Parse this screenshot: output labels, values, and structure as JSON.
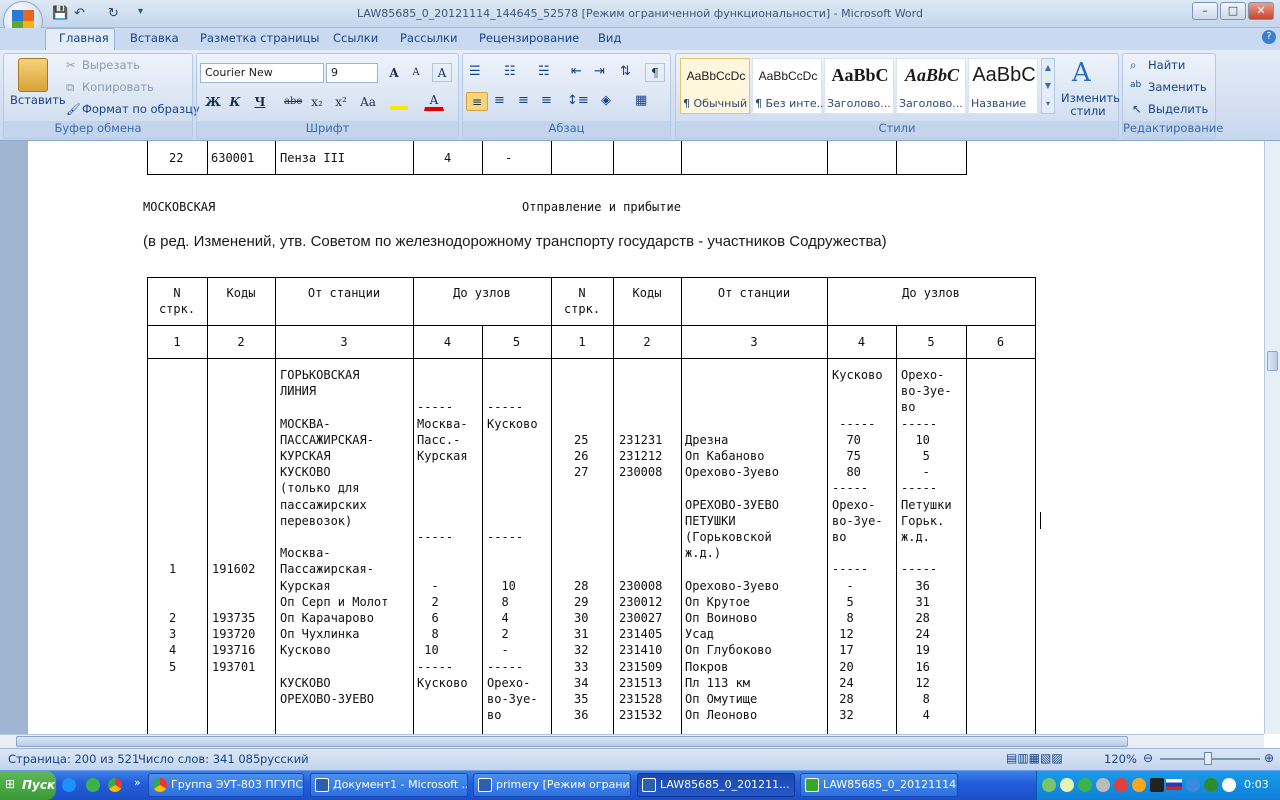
{
  "window": {
    "title": "LAW85685_0_20121114_144645_52578 [Режим ограниченной функциональности] - Microsoft Word",
    "controls": {
      "minimize": "–",
      "maximize": "□",
      "close": "✕"
    }
  },
  "quick_access": {
    "save": "💾",
    "undo": "↶",
    "redo": "↻",
    "more": "▾"
  },
  "tabs": [
    "Главная",
    "Вставка",
    "Разметка страницы",
    "Ссылки",
    "Рассылки",
    "Рецензирование",
    "Вид"
  ],
  "ribbon": {
    "clipboard": {
      "paste": "Вставить",
      "cut": "Вырезать",
      "copy": "Копировать",
      "format_painter": "Формат по образцу",
      "label": "Буфер обмена"
    },
    "font": {
      "name": "Courier New",
      "size": "9",
      "label": "Шрифт",
      "bold": "Ж",
      "italic": "К",
      "underline": "Ч",
      "strike": "abe",
      "sub": "x₂",
      "sup": "x²",
      "case": "Aa",
      "grow": "A",
      "shrink": "A"
    },
    "paragraph": {
      "label": "Абзац",
      "pilcrow": "¶"
    },
    "styles": {
      "label": "Стили",
      "items": [
        {
          "sample": "AaBbCcDc",
          "name": "¶ Обычный"
        },
        {
          "sample": "AaBbCcDc",
          "name": "¶ Без инте..."
        },
        {
          "sample": "AaBbC",
          "name": "Заголово..."
        },
        {
          "sample": "AaBbC",
          "name": "Заголово..."
        },
        {
          "sample": "AaBbC",
          "name": "Название"
        }
      ],
      "change": "Изменить стили"
    },
    "editing": {
      "label": "Редактирование",
      "find": "Найти",
      "replace": "Заменить",
      "select": "Выделить"
    }
  },
  "document": {
    "prev_row": {
      "n": "22",
      "code": "630001",
      "station": "Пенза III",
      "c4": "4",
      "c5": "-"
    },
    "section_left": "МОСКОВСКАЯ",
    "section_right": "Отправление и прибытие",
    "edit_note": "(в ред. Изменений, утв. Советом по железнодорожному транспорту государств - участников Содружества)",
    "headers": {
      "n": "N\nстрк.",
      "codes": "Коды",
      "from": "От станции",
      "to": "До узлов",
      "n2": "N\nстрк.",
      "codes2": "Коды",
      "from2": "От станции",
      "to2": "До узлов"
    },
    "col_numbers": [
      "1",
      "2",
      "3",
      "4",
      "5",
      "1",
      "2",
      "3",
      "4",
      "5",
      "6"
    ],
    "left": {
      "col_n": "\n\n\n\n\n\n\n\n\n\n\n\n1\n\n\n2\n3\n4\n5",
      "col_code": "\n\n\n\n\n\n\n\n\n\n\n\n191602\n\n\n193735\n193720\n193716\n193701",
      "col_station": "ГОРЬКОВСКАЯ\nЛИНИЯ\n\nМОСКВА-\nПАССАЖИРСКАЯ-\nКУРСКАЯ\nКУСКОВО\n(только для\nпассажирских\nперевозок)\n\nМосква-\nПассажирская-\nКурская\nОп Серп и Молот\nОп Карачарово\nОп Чухлинка\nКусково\n\nКУСКОВО\nОРЕХОВО-ЗУЕВО",
      "col_4": "\n\n-----\nМосква-\nПасс.-\nКурская\n\n\n\n\n-----\n\n\n  -\n  2\n  6\n  8\n 10\n-----\nКусково",
      "col_5": "\n\n-----\nКусково\n\n\n\n\n\n\n-----\n\n\n  10\n  8\n  4\n  2\n  -\n-----\nОрехо-\nво-Зуе-\nво"
    },
    "right": {
      "col_n": "\n\n\n\n25\n26\n27\n\n\n\n\n\n\n28\n29\n30\n31\n32\n33\n34\n35\n36",
      "col_code": "\n\n\n\n231231\n231212\n230008\n\n\n\n\n\n\n230008\n230012\n230027\n231405\n231410\n231509\n231513\n231528\n231532",
      "col_station": "\n\n\n\nДрезна\nОп Кабаново\nОрехово-Зуево\n\nОРЕХОВО-ЗУЕВО\nПЕТУШКИ\n(Горьковской\nж.д.)\n\nОрехово-Зуево\nОп Крутое\nОп Воиново\nУсад\nОп Глубоково\nПокров\nПл 113 км\nОп Омутище\nОп Леоново",
      "col_4": "Кусково\n\n\n -----\n  70\n  75\n  80\n-----\nОрехо-\nво-Зуе-\nво\n\n-----\n  -\n  5\n  8\n 12\n 17\n 20\n 24\n 28\n 32",
      "col_5": "Орехо-\nво-Зуе-\nво\n-----\n  10\n   5\n   -\n-----\nПетушки\nГорьк.\nж.д.\n\n-----\n  36\n  31\n  28\n  24\n  19\n  16\n  12\n   8\n   4"
    }
  },
  "status": {
    "page": "Страница: 200 из 521",
    "words": "Число слов: 341 085",
    "lang": "русский",
    "zoom": "120%"
  },
  "taskbar": {
    "start": "Пуск",
    "tasks": [
      "Группа ЭУТ-803 ПГУПС...",
      "Документ1 - Microsoft ...",
      "primery [Режим огранич...",
      "LAW85685_0_201211...",
      "LAW85685_0_20121114..."
    ],
    "clock": "0:03"
  }
}
